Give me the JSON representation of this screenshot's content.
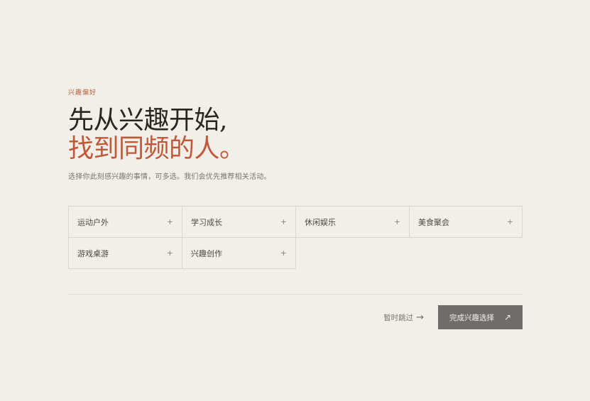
{
  "eyebrow": "兴趣偏好",
  "headline": {
    "line1": "先从兴趣开始,",
    "line2": "找到同频的人。"
  },
  "subtitle": "选择你此刻感兴趣的事情，可多选。我们会优先推荐相关活动。",
  "interests": [
    {
      "label": "运动户外",
      "icon": "plus-icon",
      "symbol": "+"
    },
    {
      "label": "学习成长",
      "icon": "plus-icon",
      "symbol": "+"
    },
    {
      "label": "休闲娱乐",
      "icon": "plus-icon",
      "symbol": "+"
    },
    {
      "label": "美食聚会",
      "icon": "plus-icon",
      "symbol": "+"
    },
    {
      "label": "游戏桌游",
      "icon": "plus-icon",
      "symbol": "+"
    },
    {
      "label": "兴趣创作",
      "icon": "plus-icon",
      "symbol": "+"
    }
  ],
  "actions": {
    "skip_label": "暂时跳过",
    "skip_icon": "→",
    "complete_label": "完成兴趣选择",
    "complete_icon": "↗"
  },
  "colors": {
    "background": "#f2efe9",
    "accent": "#c0583a",
    "text": "#2a2622",
    "button": "#6f6d69"
  }
}
